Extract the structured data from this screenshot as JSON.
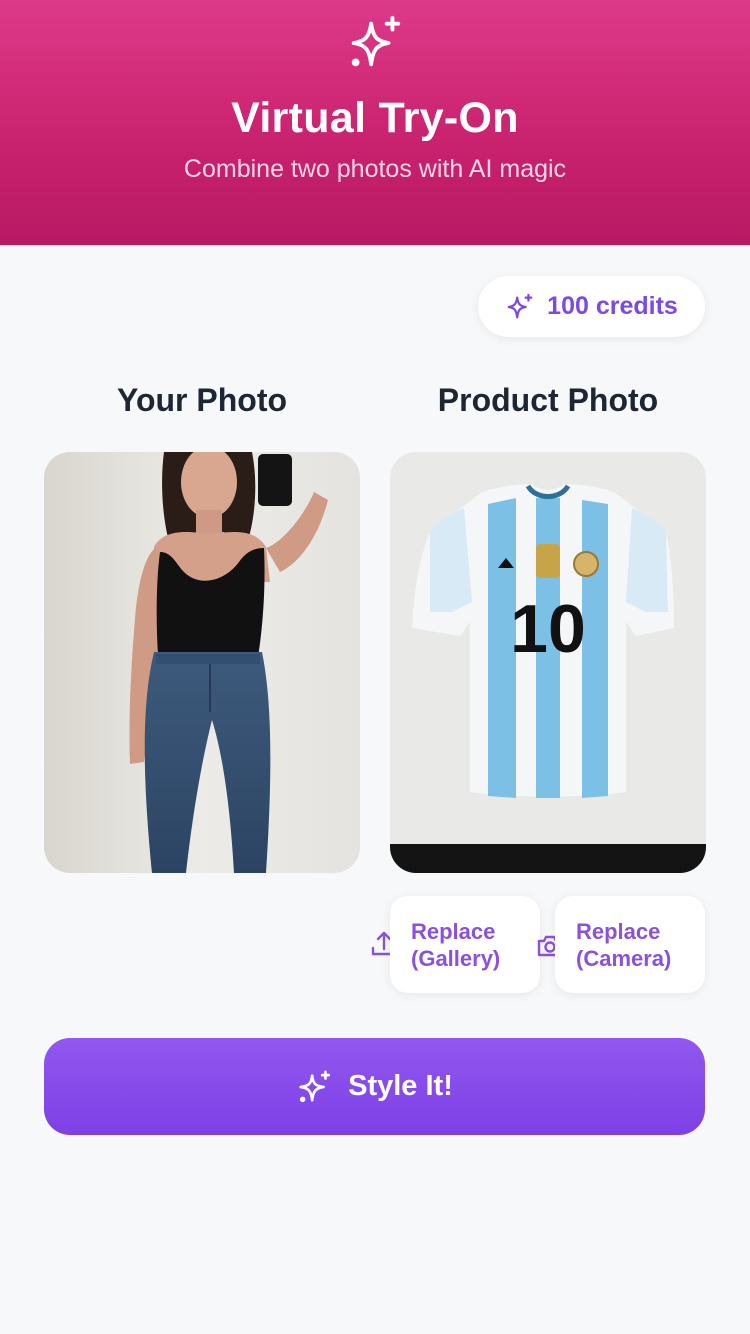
{
  "header": {
    "title": "Virtual Try-On",
    "subtitle": "Combine two photos with AI magic",
    "logo_icon": "sparkles-icon",
    "colors": {
      "top": "#de3a8a",
      "bottom": "#b81a63"
    }
  },
  "credits": {
    "label": "100 credits",
    "icon": "sparkles-icon",
    "color": "#7c4ae0"
  },
  "your_photo": {
    "title": "Your Photo"
  },
  "product_photo": {
    "title": "Product Photo"
  },
  "actions": {
    "replace_gallery": {
      "line1": "Replace",
      "line2": "(Gallery)",
      "icon": "upload-icon"
    },
    "replace_camera": {
      "line1": "Replace",
      "line2": "(Camera)",
      "icon": "camera-icon"
    }
  },
  "style_button": {
    "label": "Style It!",
    "icon": "sparkles-icon",
    "color": "#8a4cec"
  }
}
